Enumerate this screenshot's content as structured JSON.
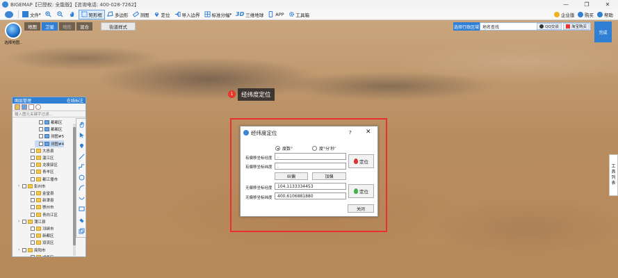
{
  "window": {
    "title": "BIGEMAP【已授权: 全能版】【咨询电话: 400-028-7262】",
    "controls": [
      "—",
      "❐",
      "✕"
    ]
  },
  "toolbar": {
    "file": "文件",
    "rect_select": "矩形框",
    "polygon": "多边形",
    "measure": "测图",
    "locate": "定位",
    "import_boundary": "导入边界",
    "standard_tiles": "标准分幅",
    "three_d_icon": "3D",
    "three_d": "三维地球",
    "app": "APP",
    "toolbox": "工具箱",
    "enterprise": "企业版",
    "buy": "购买",
    "help": "帮助"
  },
  "map": {
    "tabs": [
      {
        "label": "地图",
        "selected": false
      },
      {
        "label": "卫星",
        "selected": true
      },
      {
        "label": "地形",
        "selected": false
      },
      {
        "label": "混合",
        "selected": false
      }
    ],
    "street_style": "街道样式",
    "globe_label": "选择地图..",
    "region_select": "选择行政区域",
    "search_placeholder": "地名查找",
    "qq_button": "QQ交谈",
    "taobao_button": "淘宝购买",
    "finish_button": "完成",
    "marker_number": "1",
    "marker_label": "经纬度定位",
    "right_tab": [
      "工",
      "具",
      "列",
      "表"
    ]
  },
  "layers": {
    "title": "图层管理",
    "online_label": "在线标注",
    "filter_placeholder": "输入图元关键字过滤...",
    "items": [
      {
        "label": "都都区",
        "indent": 3,
        "type": "leaf"
      },
      {
        "label": "都都区",
        "indent": 3,
        "type": "leaf"
      },
      {
        "label": "测图#5",
        "indent": 3,
        "type": "leaf"
      },
      {
        "label": "测图#4",
        "indent": 3,
        "type": "leaf",
        "highlighted": true
      },
      {
        "label": "大邑县",
        "indent": 2,
        "type": "folder"
      },
      {
        "label": "温江区",
        "indent": 2,
        "type": "folder"
      },
      {
        "label": "龙泉驿区",
        "indent": 2,
        "type": "folder"
      },
      {
        "label": "青羊区",
        "indent": 2,
        "type": "folder"
      },
      {
        "label": "都江堰市",
        "indent": 2,
        "type": "folder"
      },
      {
        "label": "彭州市",
        "indent": 1,
        "type": "folder-expand"
      },
      {
        "label": "金堂县",
        "indent": 2,
        "type": "folder"
      },
      {
        "label": "新津县",
        "indent": 2,
        "type": "folder"
      },
      {
        "label": "崇州市",
        "indent": 2,
        "type": "folder"
      },
      {
        "label": "青白江区",
        "indent": 2,
        "type": "folder"
      },
      {
        "label": "蒲江县",
        "indent": 1,
        "type": "folder-expand"
      },
      {
        "label": "邛崃市",
        "indent": 2,
        "type": "folder"
      },
      {
        "label": "新都区",
        "indent": 2,
        "type": "folder"
      },
      {
        "label": "双流区",
        "indent": 2,
        "type": "folder"
      },
      {
        "label": "简阳市",
        "indent": 1,
        "type": "folder-expand"
      },
      {
        "label": "成华区",
        "indent": 2,
        "type": "folder"
      }
    ]
  },
  "dialog": {
    "title": "经纬度定位",
    "help": "?",
    "close": "✕",
    "radio_degree": "度数°",
    "radio_dms": "度°分′秒″",
    "offset_lng_label": "有偏移坐标经度",
    "offset_lat_label": "有偏移坐标纬度",
    "offset_lng_value": ".",
    "offset_lat_value": ".",
    "locate_top": "定位",
    "correct": "纠偏",
    "add_offset": "加偏",
    "no_offset_lng_label": "无偏移坐标经度",
    "no_offset_lat_label": "无偏移坐标纬度",
    "no_offset_lng_value": "104.1133334453",
    "no_offset_lat_value": "400.6106881880",
    "locate_bottom": "定位",
    "close_button": "关闭"
  },
  "colors": {
    "accent": "#2f7fd5",
    "highlight_box": "#e8312a",
    "marker": "#e8362a"
  }
}
